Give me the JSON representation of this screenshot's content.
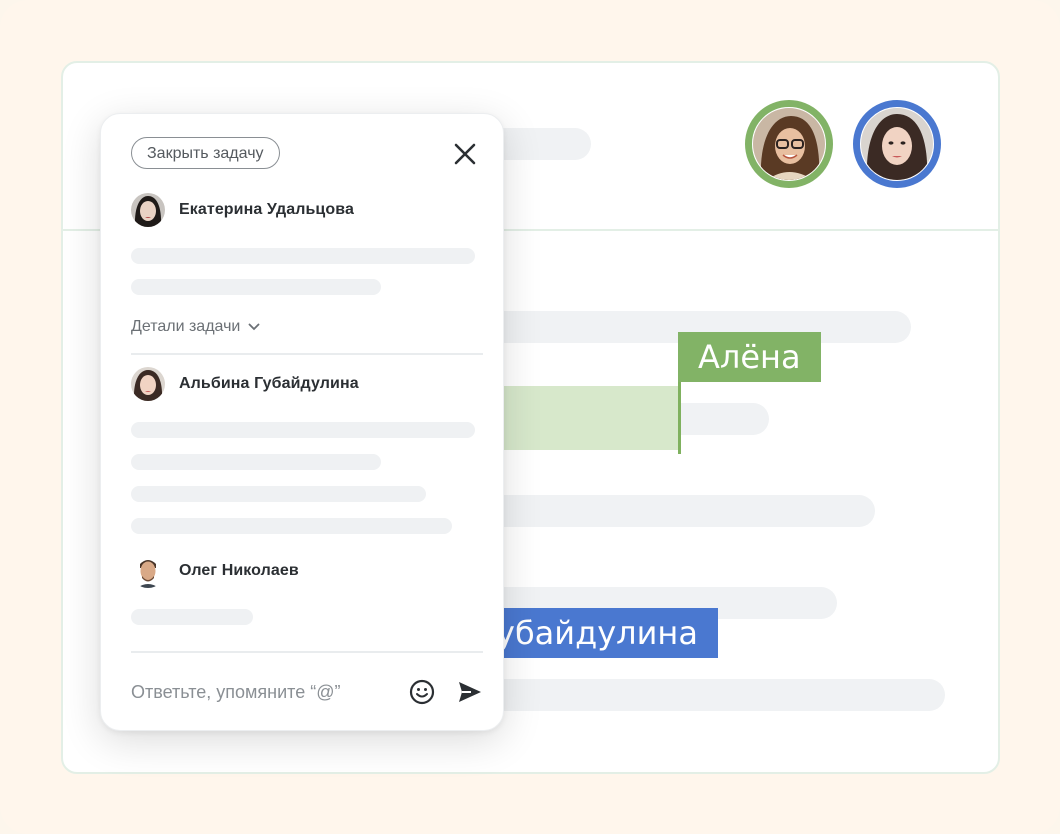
{
  "background": {
    "color": "#fff6ec"
  },
  "document": {
    "collaborators": [
      {
        "name": "Алёна",
        "ring_color": "#82b366"
      },
      {
        "name": "Альбина Губайдулина",
        "ring_color": "#4a78d0"
      }
    ],
    "cursor_tags": {
      "alena": {
        "text": "Алёна",
        "color": "#82b366"
      },
      "gubaidulina": {
        "text": "убайдулина",
        "color": "#4a78d0"
      }
    }
  },
  "panel": {
    "close_task_label": "Закрыть задачу",
    "close_icon": "close-icon",
    "details_label": "Детали задачи",
    "comments": [
      {
        "author": "Екатерина Удальцова"
      },
      {
        "author": "Альбина Губайдулина"
      },
      {
        "author": "Олег Николаев"
      }
    ],
    "reply": {
      "placeholder": "Ответьте, упомяните “@”",
      "emoji_icon": "emoji-icon",
      "send_icon": "send-icon"
    }
  }
}
